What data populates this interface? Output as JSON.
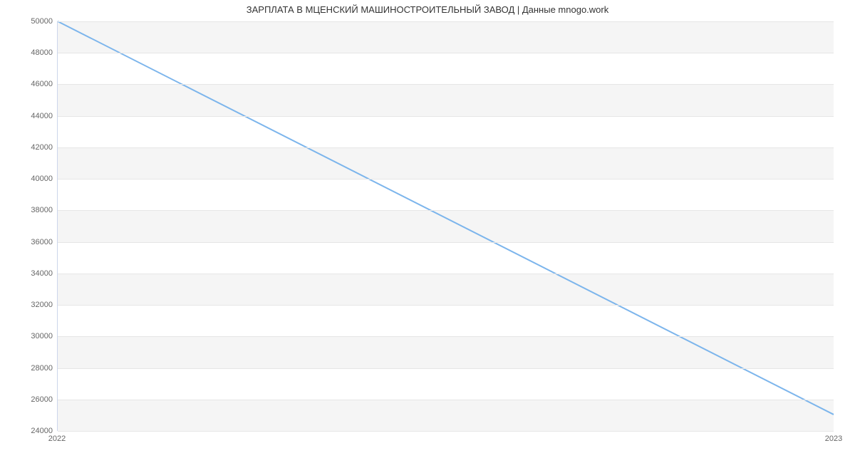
{
  "chart_data": {
    "type": "line",
    "title": "ЗАРПЛАТА В  МЦЕНСКИЙ МАШИНОСТРОИТЕЛЬНЫЙ ЗАВОД | Данные mnogo.work",
    "x": [
      2022,
      2023
    ],
    "values": [
      50000,
      25000
    ],
    "x_ticks": [
      "2022",
      "2023"
    ],
    "y_ticks": [
      24000,
      26000,
      28000,
      30000,
      32000,
      34000,
      36000,
      38000,
      40000,
      42000,
      44000,
      46000,
      48000,
      50000
    ],
    "ylim": [
      24000,
      50000
    ],
    "xlim": [
      2022,
      2023
    ],
    "xlabel": "",
    "ylabel": "",
    "line_color": "#7cb5ec"
  }
}
